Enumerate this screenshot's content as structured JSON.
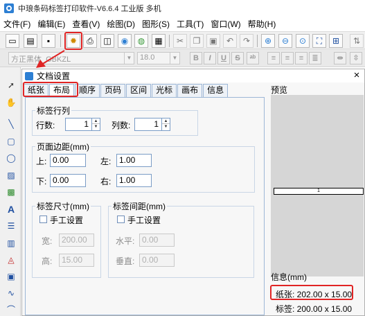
{
  "window": {
    "title": "中琅条码标签打印软件-V6.6.4 工业版 多机"
  },
  "menu": [
    "文件(F)",
    "编辑(E)",
    "查看(V)",
    "绘图(D)",
    "图形(S)",
    "工具(T)",
    "窗口(W)",
    "帮助(H)"
  ],
  "toolbar": {
    "buttons": [
      {
        "name": "new-icon",
        "glyph": "▭"
      },
      {
        "name": "open-icon",
        "glyph": "▤"
      },
      {
        "name": "save-icon",
        "glyph": "▪"
      },
      {
        "name": "document-settings-gear-icon",
        "glyph": "✹"
      },
      {
        "name": "print-icon",
        "glyph": "⎙"
      },
      {
        "name": "print-preview-icon",
        "glyph": "◫"
      },
      {
        "name": "database-icon",
        "glyph": "◉"
      },
      {
        "name": "data-source-icon",
        "glyph": "◍"
      },
      {
        "name": "grid-icon",
        "glyph": "▦"
      },
      {
        "name": "cut-icon",
        "glyph": "✂"
      },
      {
        "name": "copy-icon",
        "glyph": "❐"
      },
      {
        "name": "paste-icon",
        "glyph": "▣"
      },
      {
        "name": "undo-icon",
        "glyph": "↶"
      },
      {
        "name": "redo-icon",
        "glyph": "↷"
      },
      {
        "name": "zoom-in-icon",
        "glyph": "⊕"
      },
      {
        "name": "zoom-out-icon",
        "glyph": "⊖"
      },
      {
        "name": "zoom-fit-icon",
        "glyph": "⊙"
      },
      {
        "name": "fit-page-icon",
        "glyph": "⛶"
      },
      {
        "name": "actual-size-icon",
        "glyph": "⊞"
      },
      {
        "name": "more-tools-icon",
        "glyph": "⇅"
      }
    ]
  },
  "format_toolbar": {
    "font_name": "方正黑体_GBKZL",
    "font_size": "18.0",
    "bold": "B",
    "italic": "I",
    "underline": "U",
    "strike": "S"
  },
  "left_tools": [
    "pointer-icon",
    "hand-icon",
    "line-icon",
    "rectangle-icon",
    "ellipse-icon",
    "image-icon",
    "picture-icon",
    "text-icon",
    "paragraph-icon",
    "barcode-icon",
    "shape-icon",
    "qrcode-icon",
    "curve-icon",
    "arc-icon"
  ],
  "dialog": {
    "title": "文档设置",
    "close": "×",
    "tabs": [
      "纸张",
      "布局",
      "顺序",
      "页码",
      "区间",
      "光标",
      "画布",
      "信息"
    ],
    "active_tab": "布局",
    "layout": {
      "rows_cols_title": "标签行列",
      "rows_label": "行数:",
      "rows_value": "1",
      "cols_label": "列数:",
      "cols_value": "1",
      "margins_title": "页面边距(mm)",
      "top_label": "上:",
      "top_value": "0.00",
      "left_label": "左:",
      "left_value": "1.00",
      "bottom_label": "下:",
      "bottom_value": "0.00",
      "right_label": "右:",
      "right_value": "1.00",
      "size_title": "标签尺寸(mm)",
      "manual_size_label": "手工设置",
      "width_label": "宽:",
      "width_value": "200.00",
      "height_label": "高:",
      "height_value": "15.00",
      "spacing_title": "标签间距(mm)",
      "manual_spacing_label": "手工设置",
      "horizontal_label": "水平:",
      "horizontal_value": "0.00",
      "vertical_label": "垂直:",
      "vertical_value": "0.00"
    },
    "preview": {
      "title": "预览",
      "label_text": "1",
      "info_title": "信息(mm)",
      "paper_line": "纸张: 202.00 x 15.00",
      "label_line": "标签: 200.00 x 15.00"
    }
  },
  "colors": {
    "highlight": "#e02424",
    "accent": "#2d7fd3",
    "tab_border": "#9cb6d6"
  }
}
